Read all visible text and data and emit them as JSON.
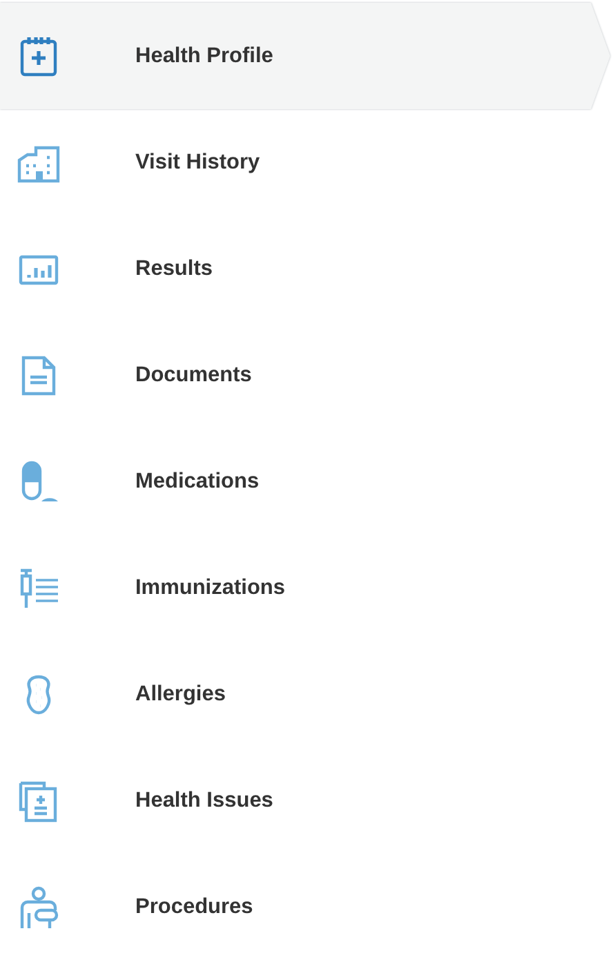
{
  "menu": {
    "items": [
      {
        "label": "Health Profile",
        "selected": true
      },
      {
        "label": "Visit History",
        "selected": false
      },
      {
        "label": "Results",
        "selected": false
      },
      {
        "label": "Documents",
        "selected": false
      },
      {
        "label": "Medications",
        "selected": false
      },
      {
        "label": "Immunizations",
        "selected": false
      },
      {
        "label": "Allergies",
        "selected": false
      },
      {
        "label": "Health Issues",
        "selected": false
      },
      {
        "label": "Procedures",
        "selected": false
      }
    ]
  }
}
